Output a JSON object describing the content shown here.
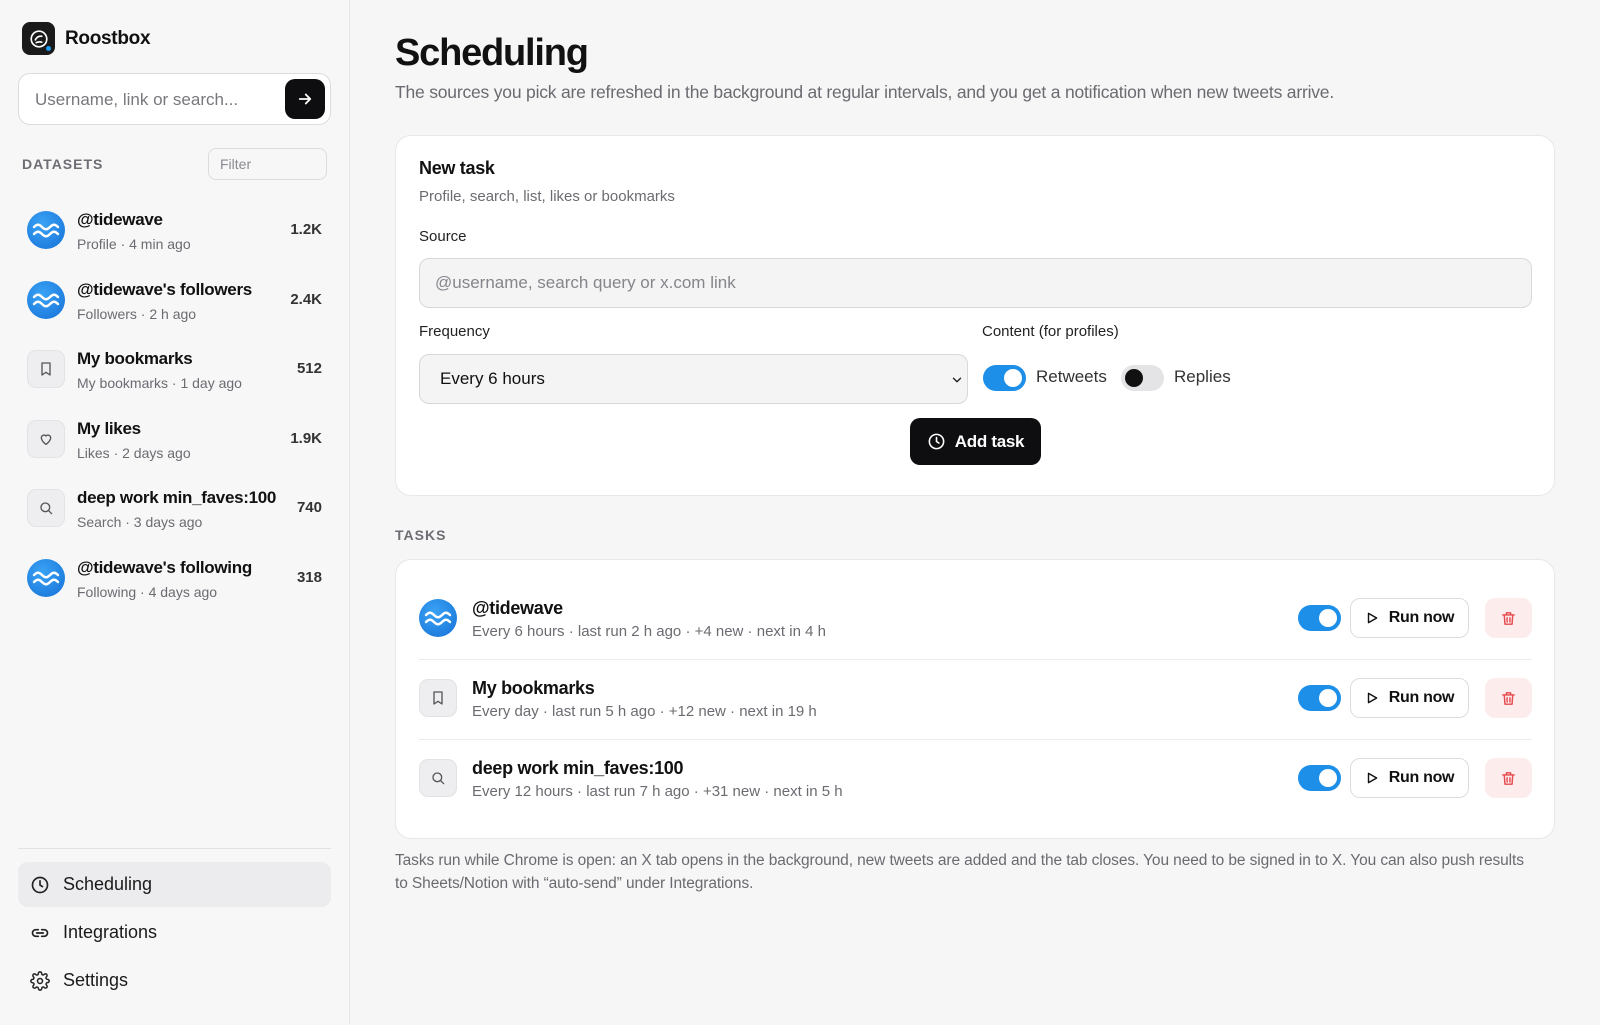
{
  "app": {
    "name": "Roostbox"
  },
  "search": {
    "placeholder": "Username, link or search..."
  },
  "datasets": {
    "title": "DATASETS",
    "filter_placeholder": "Filter",
    "items": [
      {
        "name": "@tidewave",
        "type": "Profile",
        "time": "4 min ago",
        "sub": "Profile · 4 min ago",
        "count": "1.2K",
        "icon": "wave-avatar"
      },
      {
        "name": "@tidewave's followers",
        "sub": "Followers · 2 h ago",
        "count": "2.4K",
        "icon": "wave-avatar"
      },
      {
        "name": "My bookmarks",
        "sub": "My bookmarks · 1 day ago",
        "count": "512",
        "icon": "bookmark-icon"
      },
      {
        "name": "My likes",
        "sub": "Likes · 2 days ago",
        "count": "1.9K",
        "icon": "heart-icon"
      },
      {
        "name": "deep work min_faves:100",
        "sub": "Search · 3 days ago",
        "count": "740",
        "icon": "search-icon"
      },
      {
        "name": "@tidewave's following",
        "sub": "Following · 4 days ago",
        "count": "318",
        "icon": "wave-avatar"
      }
    ]
  },
  "nav": {
    "items": [
      {
        "label": "Scheduling",
        "icon": "clock-icon",
        "active": true
      },
      {
        "label": "Integrations",
        "icon": "link-icon"
      },
      {
        "label": "Settings",
        "icon": "gear-icon"
      }
    ]
  },
  "page": {
    "title": "Scheduling",
    "subtitle": "The sources you pick are refreshed in the background at regular intervals, and you get a notification when new tweets arrive."
  },
  "new_task": {
    "title": "New task",
    "subtitle": "Profile, search, list, likes or bookmarks",
    "source_label": "Source",
    "source_placeholder": "@username, search query or x.com link",
    "frequency_label": "Frequency",
    "frequency_value": "Every 6 hours",
    "content_label": "Content (for profiles)",
    "retweets_label": "Retweets",
    "retweets_on": true,
    "replies_label": "Replies",
    "replies_on": false,
    "add_label": "Add task"
  },
  "tasks": {
    "title": "TASKS",
    "run_label": "Run now",
    "items": [
      {
        "name": "@tidewave",
        "sub": "Every 6 hours · last run 2 h ago · +4 new · next in 4 h",
        "enabled": true,
        "icon": "wave-avatar"
      },
      {
        "name": "My bookmarks",
        "sub": "Every day · last run 5 h ago · +12 new · next in 19 h",
        "enabled": true,
        "icon": "bookmark-icon"
      },
      {
        "name": "deep work min_faves:100",
        "sub": "Every 12 hours · last run 7 h ago · +31 new · next in 5 h",
        "enabled": true,
        "icon": "search-icon"
      }
    ]
  },
  "footnote": "Tasks run while Chrome is open: an X tab opens in the background, new tweets are added and the tab closes. You need to be signed in to X. You can also push results to Sheets/Notion with “auto-send” under Integrations.",
  "colors": {
    "accent": "#1d8fe8",
    "primary_button": "#0e0e10",
    "danger_bg": "#fdecec",
    "danger": "#e5484d"
  }
}
